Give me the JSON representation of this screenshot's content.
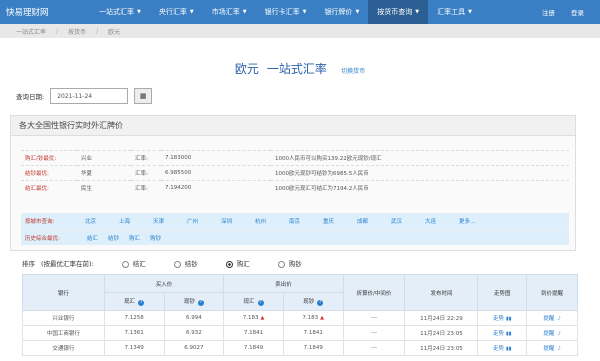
{
  "nav": {
    "logo": "快易理财网",
    "items": [
      {
        "label": "一站式汇率",
        "caret": true
      },
      {
        "label": "央行汇率",
        "caret": true
      },
      {
        "label": "市场汇率",
        "caret": true
      },
      {
        "label": "银行卡汇率",
        "caret": true
      },
      {
        "label": "银行牌价",
        "caret": true
      },
      {
        "label": "按货币查询",
        "caret": true,
        "active": true
      },
      {
        "label": "汇率工具",
        "caret": true
      }
    ],
    "register": "注册",
    "login": "登录"
  },
  "breadcrumb": [
    "一站式汇率",
    "按货币",
    "欧元"
  ],
  "title": {
    "currency": "欧元",
    "suffix": "一站式汇率",
    "switch": "切换货币"
  },
  "date": {
    "label": "查询日期:",
    "value": "2021-11-24"
  },
  "panel": {
    "heading": "各大全国性银行实时外汇牌价",
    "rows": [
      {
        "label": "购汇/钞最优:",
        "bank": "兴业",
        "rate_label": "汇率:",
        "rate": "7.183000",
        "desc": "1000人民币可以购买139.22欧元现钞/现汇"
      },
      {
        "label": "结钞最优:",
        "bank": "华夏",
        "rate_label": "汇率:",
        "rate": "6.985500",
        "desc": "1000欧元现钞可结钞为6985.5人民币"
      },
      {
        "label": "结汇最优:",
        "bank": "民生",
        "rate_label": "汇率:",
        "rate": "7.194200",
        "desc": "1000欧元现汇可结汇为7194.2人民币"
      }
    ],
    "cities_label": "按城市查询:",
    "cities": [
      "北京",
      "上海",
      "天津",
      "广州",
      "深圳",
      "杭州",
      "南京",
      "重庆",
      "成都",
      "武汉",
      "大连",
      "更多..."
    ],
    "history_label": "历史综合最优:",
    "history_opts": [
      "结汇",
      "结钞",
      "购汇",
      "购钞"
    ]
  },
  "sort": {
    "label": "排序",
    "hint": "(按最优汇率在前):",
    "options": [
      {
        "label": "结汇",
        "checked": false
      },
      {
        "label": "结钞",
        "checked": false
      },
      {
        "label": "购汇",
        "checked": true
      },
      {
        "label": "购钞",
        "checked": false
      }
    ]
  },
  "table": {
    "headers": {
      "bank": "银行",
      "buy": "买入价",
      "sell": "卖出价",
      "buy_spot": "现汇",
      "buy_cash": "现钞",
      "sell_spot": "现汇",
      "sell_cash": "现钞",
      "mid": "折算价/中间价",
      "time": "发布时间",
      "trend": "走势图",
      "alert": "到价提醒"
    },
    "rows": [
      {
        "bank": "兴业银行",
        "buy_spot": "7.1258",
        "buy_cash": "6.994",
        "sell_spot": "7.183",
        "sell_cash": "7.183",
        "mid": "---",
        "time": "11月24日 22:29",
        "trend": "走势",
        "alert": "提醒"
      },
      {
        "bank": "中国工商银行",
        "buy_spot": "7.1361",
        "buy_cash": "6.932",
        "sell_spot": "7.1841",
        "sell_cash": "7.1841",
        "mid": "---",
        "time": "11月24日 23:05",
        "trend": "走势",
        "alert": "提醒"
      },
      {
        "bank": "交通银行",
        "buy_spot": "7.1349",
        "buy_cash": "6.9027",
        "sell_spot": "7.1849",
        "sell_cash": "7.1849",
        "mid": "---",
        "time": "11月24日 23:05",
        "trend": "走势",
        "alert": "提醒"
      }
    ]
  }
}
